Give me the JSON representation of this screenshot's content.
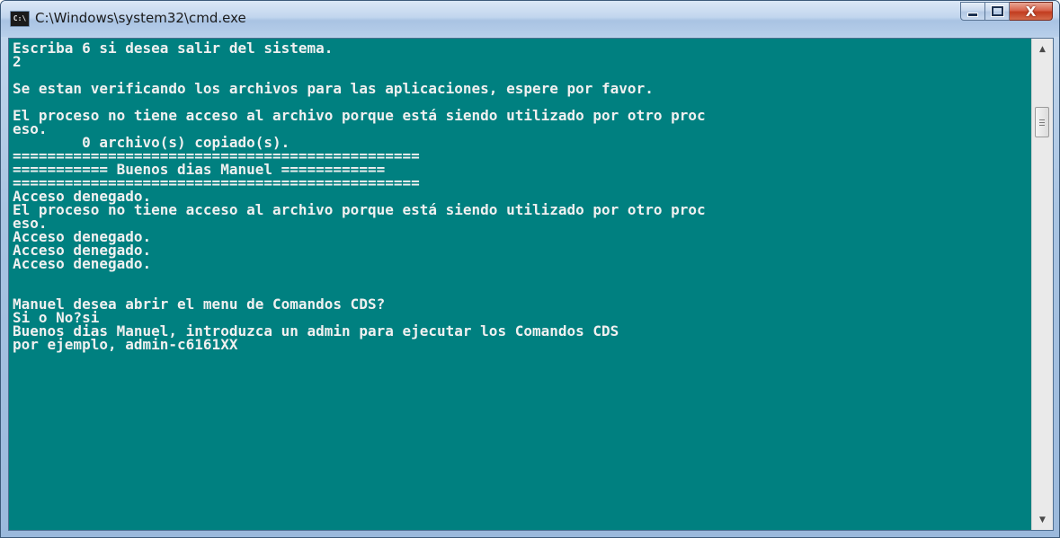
{
  "window": {
    "title": "C:\\Windows\\system32\\cmd.exe",
    "app_icon_text": "C:\\",
    "icon": "cmd-icon",
    "buttons": {
      "minimize": "minimize-icon",
      "maximize": "maximize-icon",
      "close_glyph": "X"
    }
  },
  "colors": {
    "console_background": "#008080",
    "console_text": "#f0f0f0"
  },
  "console": {
    "lines": [
      "Escriba 6 si desea salir del sistema.",
      "2",
      "",
      "Se estan verificando los archivos para las aplicaciones, espere por favor.",
      "",
      "El proceso no tiene acceso al archivo porque está siendo utilizado por otro proc",
      "eso.",
      "        0 archivo(s) copiado(s).",
      "===============================================",
      "=========== Buenos dias Manuel ============",
      "===============================================",
      "Acceso denegado.",
      "El proceso no tiene acceso al archivo porque está siendo utilizado por otro proc",
      "eso.",
      "Acceso denegado.",
      "Acceso denegado.",
      "Acceso denegado.",
      "",
      "",
      "Manuel desea abrir el menu de Comandos CDS?",
      "Si o No?si",
      "Buenos dias Manuel, introduzca un admin para ejecutar los Comandos CDS",
      "por ejemplo, admin-c6161XX"
    ]
  },
  "scrollbar": {
    "up_icon": "scroll-up-arrow-icon",
    "down_icon": "scroll-down-arrow-icon",
    "up_glyph": "▲",
    "down_glyph": "▼"
  }
}
